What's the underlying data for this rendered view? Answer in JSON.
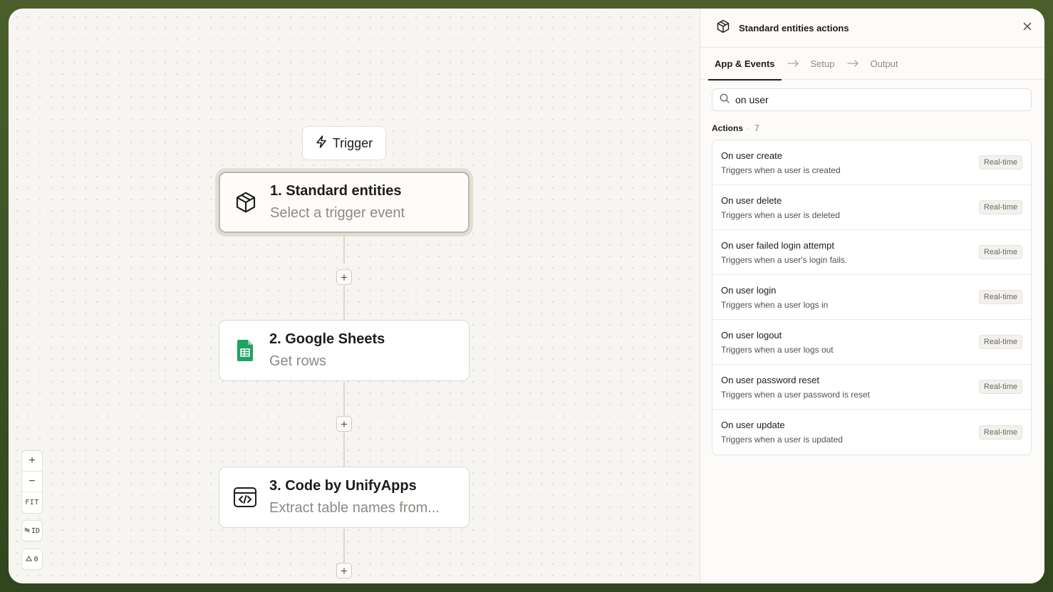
{
  "canvas": {
    "trigger_label": "Trigger",
    "nodes": [
      {
        "title": "1. Standard entities",
        "subtitle": "Select a trigger event",
        "icon": "cube-icon"
      },
      {
        "title": "2. Google Sheets",
        "subtitle": "Get rows",
        "icon": "google-sheets-icon"
      },
      {
        "title": "3. Code by UnifyApps",
        "subtitle": "Extract table names from...",
        "icon": "code-icon"
      }
    ],
    "controls": {
      "zoom_in": "+",
      "zoom_out": "−",
      "fit": "FIT",
      "id_toggle": "ID",
      "warnings": "0"
    }
  },
  "panel": {
    "title": "Standard entities actions",
    "tabs": [
      {
        "label": "App & Events",
        "active": true
      },
      {
        "label": "Setup",
        "active": false
      },
      {
        "label": "Output",
        "active": false
      }
    ],
    "search_value": "on user",
    "actions_label": "Actions",
    "actions_count": "7",
    "actions": [
      {
        "name": "On user create",
        "desc": "Triggers when a user is created",
        "badge": "Real-time"
      },
      {
        "name": "On user delete",
        "desc": "Triggers when a user is deleted",
        "badge": "Real-time"
      },
      {
        "name": "On user failed login attempt",
        "desc": "Triggers when a user's login fails.",
        "badge": "Real-time"
      },
      {
        "name": "On user login",
        "desc": "Triggers when a user logs in",
        "badge": "Real-time"
      },
      {
        "name": "On user logout",
        "desc": "Triggers when a user logs out",
        "badge": "Real-time"
      },
      {
        "name": "On user password reset",
        "desc": "Triggers when a user password is reset",
        "badge": "Real-time"
      },
      {
        "name": "On user update",
        "desc": "Triggers when a user is updated",
        "badge": "Real-time"
      }
    ]
  },
  "colors": {
    "frame_background": "#3e5226",
    "canvas": "#f6f5f2",
    "sheets_green": "#1ea362"
  }
}
